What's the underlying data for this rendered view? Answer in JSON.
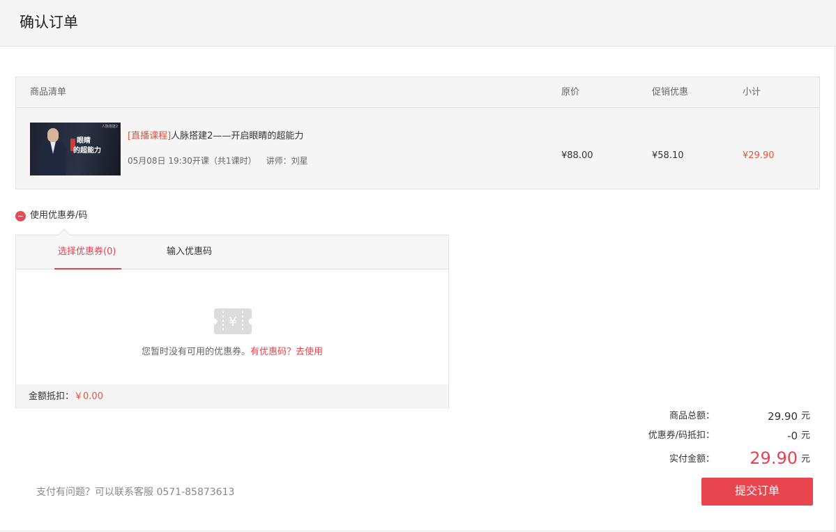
{
  "header": {
    "title": "确认订单"
  },
  "table": {
    "columns": {
      "list": "商品清单",
      "price": "原价",
      "promo": "促销优惠",
      "subtotal": "小计"
    },
    "rows": [
      {
        "thumb_text_1": "眼睛",
        "thumb_text_2": "的超能力",
        "thumb_tag": "人脉搭建2",
        "live_tag": "[直播课程]",
        "title": "人脉搭建2——开启眼睛的超能力",
        "meta": "05月08日 19:30开课（共1课时）",
        "teacher": "讲师：刘星",
        "price": "¥88.00",
        "promo": "¥58.10",
        "subtotal": "¥29.90"
      }
    ]
  },
  "coupon": {
    "toggle_label": "使用优惠券/码",
    "tabs": [
      "选择优惠券(0)",
      "输入优惠码"
    ],
    "active_tab": 0,
    "icon": "ticket-yuan-icon",
    "empty_text": "您暂时没有可用的优惠券。",
    "empty_link": "有优惠码？去使用",
    "deduct_label": "金额抵扣：",
    "deduct_value": "￥0.00"
  },
  "summary": {
    "goods_total_label": "商品总额：",
    "goods_total": "29.90",
    "coupon_deduct_label": "优惠券/码抵扣：",
    "coupon_deduct": "-0",
    "paid_label": "实付金额：",
    "paid": "29.90",
    "unit": "元"
  },
  "footer": {
    "help_text": "支付有问题？可以联系客服 0571-85873613",
    "submit_label": "提交订单"
  },
  "colors": {
    "accent": "#e8404f",
    "price_red": "#e55437",
    "header_bg": "#f5f5f5"
  }
}
